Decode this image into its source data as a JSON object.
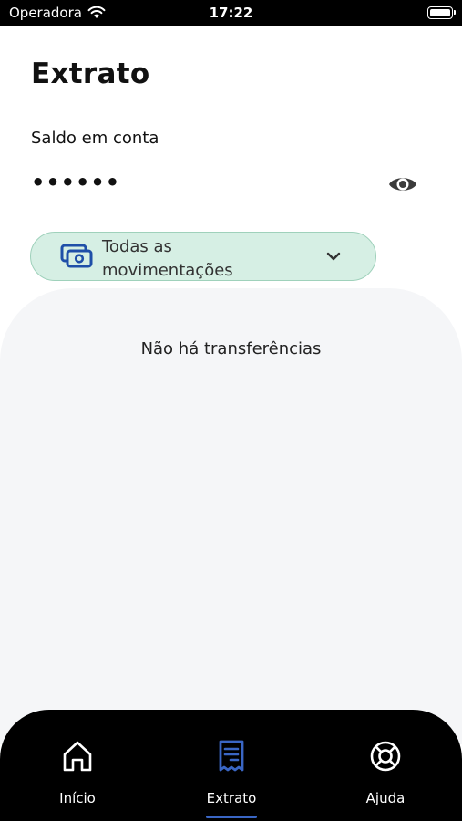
{
  "status_bar": {
    "carrier": "Operadora",
    "time": "17:22"
  },
  "header": {
    "title": "Extrato",
    "balance_label": "Saldo em conta",
    "balance_masked": "••••••"
  },
  "filter": {
    "selected": "Todas as movimentações",
    "icon": "money-icon"
  },
  "content": {
    "empty_message": "Não há transferências"
  },
  "bottom_nav": {
    "items": [
      {
        "label": "Início",
        "icon": "home-icon"
      },
      {
        "label": "Extrato",
        "icon": "receipt-icon",
        "active": true
      },
      {
        "label": "Ajuda",
        "icon": "lifebuoy-icon"
      }
    ]
  },
  "colors": {
    "status_bar_bg": "#000000",
    "filter_bg": "#d6efe4",
    "filter_border": "#9fd1bb",
    "accent_blue": "#1f4fa8",
    "panel_bg": "#f5f6f8",
    "nav_bg": "#000000",
    "nav_active_icon": "#3a66c4"
  }
}
